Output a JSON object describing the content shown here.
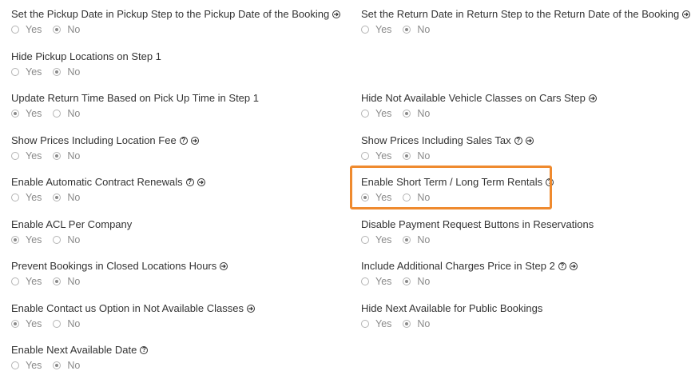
{
  "radio_labels": {
    "yes": "Yes",
    "no": "No"
  },
  "highlight_color": "#ef8a2e",
  "left_column": [
    {
      "label": "Set the Pickup Date in Pickup Step to the Pickup Date of the Booking",
      "icons": [
        "arrow-circle-right-icon"
      ],
      "value": "No"
    },
    {
      "label": "Hide Pickup Locations on Step 1",
      "icons": [],
      "value": "No"
    },
    {
      "label": "Update Return Time Based on Pick Up Time in Step 1",
      "icons": [],
      "value": "Yes"
    },
    {
      "label": "Show Prices Including Location Fee",
      "icons": [
        "help-icon",
        "arrow-circle-right-icon"
      ],
      "value": "No"
    },
    {
      "label": "Enable Automatic Contract Renewals",
      "icons": [
        "help-icon",
        "arrow-circle-right-icon"
      ],
      "value": "No"
    },
    {
      "label": "Enable ACL Per Company",
      "icons": [],
      "value": "Yes"
    },
    {
      "label": "Prevent Bookings in Closed Locations Hours",
      "icons": [
        "arrow-circle-right-icon"
      ],
      "value": "No"
    },
    {
      "label": "Enable Contact us Option in Not Available Classes",
      "icons": [
        "arrow-circle-right-icon"
      ],
      "value": "Yes"
    },
    {
      "label": "Enable Next Available Date",
      "icons": [
        "help-icon"
      ],
      "value": "No"
    }
  ],
  "right_column": [
    {
      "label": "Set the Return Date in Return Step to the Return Date of the Booking",
      "icons": [
        "arrow-circle-right-icon"
      ],
      "value": "No"
    },
    {
      "label": "Hide Not Available Vehicle Classes on Cars Step",
      "icons": [
        "arrow-circle-right-icon"
      ],
      "value": "No"
    },
    {
      "label": "Show Prices Including Sales Tax",
      "icons": [
        "help-icon",
        "arrow-circle-right-icon"
      ],
      "value": "No"
    },
    {
      "label": "Enable Short Term / Long Term Rentals",
      "icons": [
        "help-icon"
      ],
      "value": "Yes",
      "highlighted": true
    },
    {
      "label": "Disable Payment Request Buttons in Reservations",
      "icons": [],
      "value": "No"
    },
    {
      "label": "Include Additional Charges Price in Step 2",
      "icons": [
        "help-icon",
        "arrow-circle-right-icon"
      ],
      "value": "No"
    },
    {
      "label": "Hide Next Available for Public Bookings",
      "icons": [],
      "value": "No"
    }
  ]
}
